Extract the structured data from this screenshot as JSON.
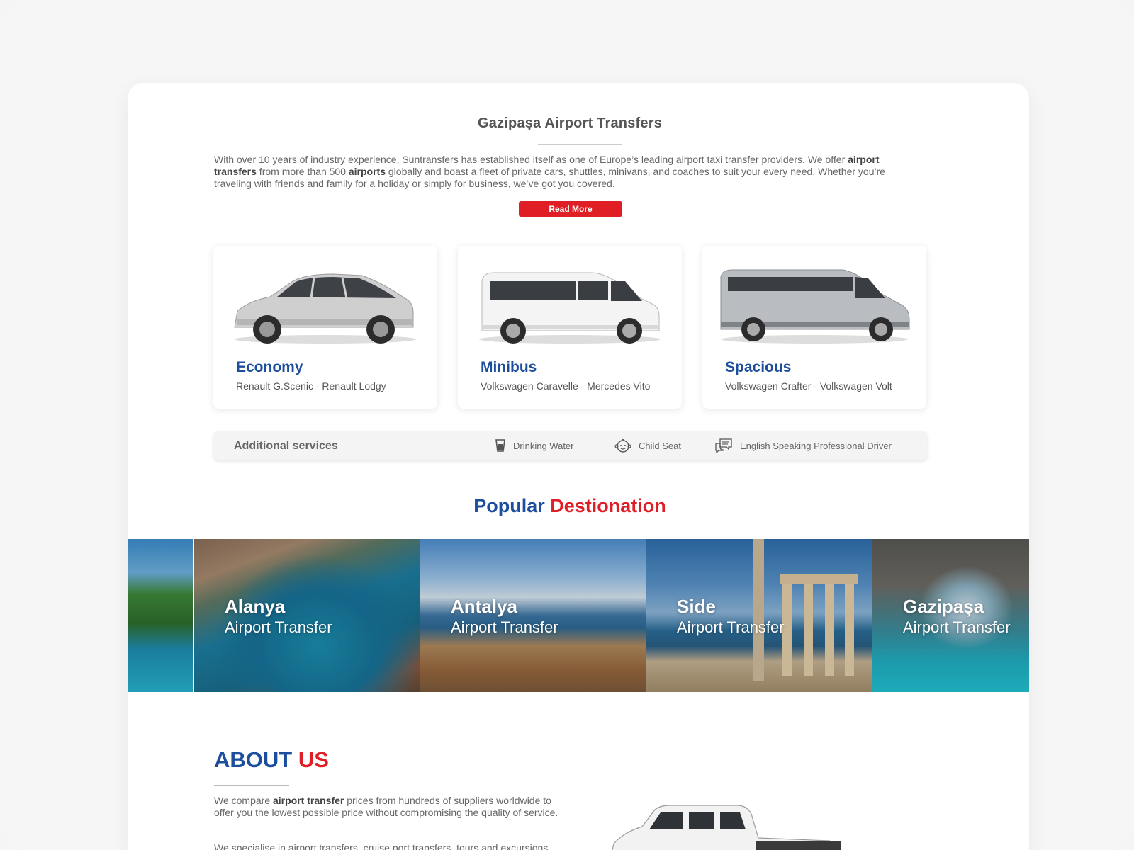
{
  "header": {
    "title": "Gazipaşa  Airport Transfers"
  },
  "intro": {
    "part1": "With over 10 years of industry experience, Suntransfers has established itself as one of Europe’s leading airport taxi transfer providers. We offer ",
    "bold1": "airport transfers",
    "part2": " from more than 500 ",
    "bold2": "airports",
    "part3": " globally and boast a fleet of private cars, shuttles, minivans, and coaches to suit your every need. Whether you’re traveling with friends and family for a holiday or simply for business, we’ve got you covered."
  },
  "read_more": {
    "label": "Read More"
  },
  "vehicles": [
    {
      "name": "Economy",
      "models": "Renault G.Scenic - Renault Lodgy",
      "icon": "mpv-car-image"
    },
    {
      "name": "Minibus",
      "models": "Volkswagen Caravelle - Mercedes Vito",
      "icon": "van-image"
    },
    {
      "name": "Spacious",
      "models": "Volkswagen Crafter - Volkswagen Volt",
      "icon": "minibus-image"
    }
  ],
  "additional_services": {
    "title": "Additional services",
    "items": [
      {
        "label": "Drinking Water",
        "icon": "cup-icon"
      },
      {
        "label": "Child Seat",
        "icon": "baby-face-icon"
      },
      {
        "label": "English Speaking Professional Driver",
        "icon": "chat-bubbles-icon"
      }
    ]
  },
  "popular": {
    "title_blue": "Popular",
    "title_red": "Destionation",
    "destinations": [
      {
        "name": "",
        "subtitle": ""
      },
      {
        "name": "Alanya",
        "subtitle": "Airport Transfer"
      },
      {
        "name": "Antalya",
        "subtitle": "Airport Transfer"
      },
      {
        "name": "Side",
        "subtitle": "Airport Transfer"
      },
      {
        "name": "Gazipaşa",
        "subtitle": "Airport Transfer"
      }
    ]
  },
  "about": {
    "title_blue": "ABOUT",
    "title_red": "US",
    "p1_part1": "We compare ",
    "p1_bold": "airport transfer",
    "p1_part2": " prices from hundreds of suppliers worldwide to offer you the lowest possible price without compromising the quality of service.",
    "p2": "We specialise in airport transfers, cruise port transfers, tours and excursions"
  },
  "colors": {
    "brand_blue": "#1c4e9d",
    "brand_red": "#e01e26",
    "text_gray": "#666666"
  }
}
